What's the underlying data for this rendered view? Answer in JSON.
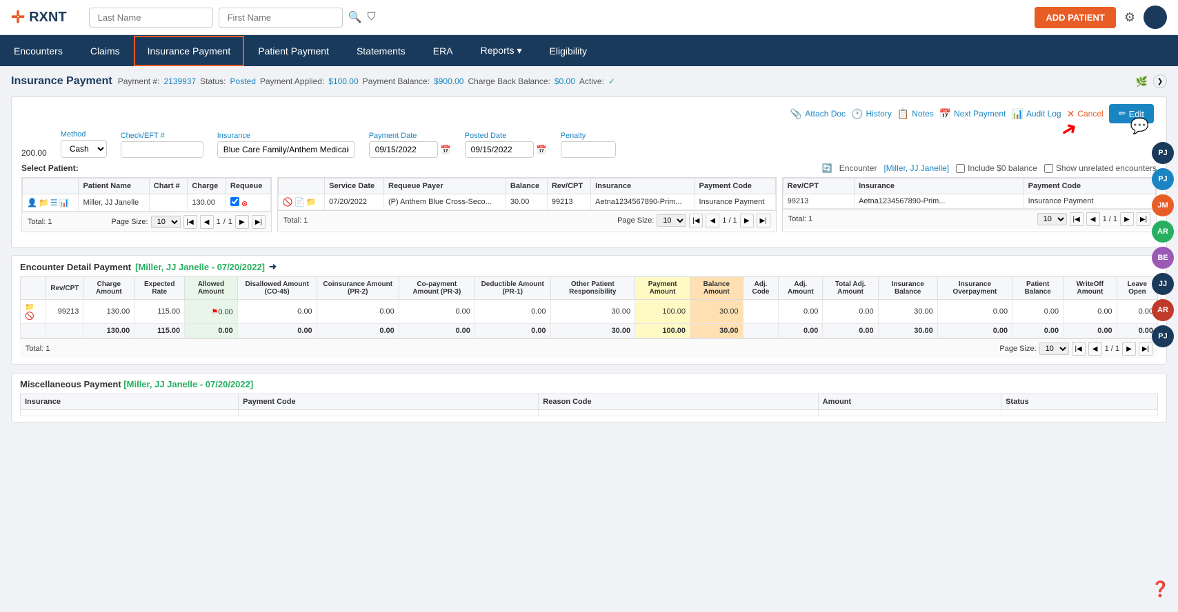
{
  "header": {
    "logo_text": "RXNT",
    "search_lastname_placeholder": "Last Name",
    "search_firstname_placeholder": "First Name",
    "add_patient_label": "ADD PATIENT"
  },
  "nav": {
    "items": [
      {
        "label": "Encounters",
        "active": false
      },
      {
        "label": "Claims",
        "active": false
      },
      {
        "label": "Insurance Payment",
        "active": true
      },
      {
        "label": "Patient Payment",
        "active": false
      },
      {
        "label": "Statements",
        "active": false
      },
      {
        "label": "ERA",
        "active": false
      },
      {
        "label": "Reports",
        "active": false,
        "has_dropdown": true
      },
      {
        "label": "Eligibility",
        "active": false
      }
    ]
  },
  "page": {
    "title": "Insurance Payment",
    "payment_num_label": "Payment #:",
    "payment_num": "2139937",
    "status_label": "Status:",
    "status_value": "Posted",
    "payment_applied_label": "Payment Applied:",
    "payment_applied_value": "$100.00",
    "payment_balance_label": "Payment Balance:",
    "payment_balance_value": "$900.00",
    "chargeback_label": "Charge Back Balance:",
    "chargeback_value": "$0.00",
    "active_label": "Active:"
  },
  "toolbar": {
    "attach_doc": "Attach Doc",
    "history": "History",
    "notes": "Notes",
    "next_payment": "Next Payment",
    "audit_log": "Audit Log",
    "cancel": "Cancel",
    "edit": "Edit"
  },
  "form": {
    "amount_value": "200.00",
    "method_label": "Method",
    "method_value": "Cash",
    "check_eft_label": "Check/EFT #",
    "insurance_label": "Insurance",
    "insurance_value": "Blue Care Family/Anthem Medicaid",
    "payment_date_label": "Payment Date",
    "payment_date_value": "09/15/2022",
    "posted_date_label": "Posted Date",
    "posted_date_value": "09/15/2022",
    "penalty_label": "Penalty"
  },
  "patient_section": {
    "label": "Select Patient:",
    "encounter_label": "Encounter",
    "encounter_name": "[Miller, JJ Janelle]",
    "include_zero_label": "Include $0 balance",
    "show_unrelated_label": "Show unrelated encounters"
  },
  "patients_table": {
    "headers": [
      "",
      "",
      "Patient Name",
      "Chart #",
      "Charge",
      "Requeue"
    ],
    "rows": [
      {
        "name": "Miller, JJ Janelle",
        "chart": "",
        "charge": "130.00",
        "requeue": true
      }
    ],
    "total": "Total: 1",
    "page_size": "10",
    "page": "1",
    "total_pages": "1"
  },
  "encounters_table": {
    "headers": [
      "",
      "",
      "Service Date",
      "Requeue Payer",
      "Balance",
      "Rev/CPT",
      "Insurance",
      "Payment Code"
    ],
    "rows": [
      {
        "service_date": "07/20/2022",
        "requeue_payer": "(P) Anthem Blue Cross-Seco...",
        "balance": "30.00",
        "rev_cpt": "99213",
        "insurance": "Aetna1234567890-Prim...",
        "payment_code": "Insurance Payment"
      }
    ],
    "total": "Total: 1",
    "page_size": "10",
    "page": "1",
    "total_pages": "1"
  },
  "detail_section": {
    "title": "Encounter Detail Payment",
    "patient_name": "[Miller, JJ Janelle - 07/20/2022]",
    "headers": [
      "Rev/CPT",
      "Charge Amount",
      "Expected Rate",
      "Allowed Amount",
      "Disallowed Amount (CO-45)",
      "Coinsurance Amount (PR-2)",
      "Co-payment Amount (PR-3)",
      "Deductible Amount (PR-1)",
      "Other Patient Responsibility",
      "Payment Amount",
      "Balance Amount",
      "Adj. Code",
      "Adj. Amount",
      "Total Adj. Amount",
      "Insurance Balance",
      "Insurance Overpayment",
      "Patient Balance",
      "WriteOff Amount",
      "Leave Open"
    ],
    "rows": [
      {
        "rev_cpt": "99213",
        "charge": "130.00",
        "expected": "115.00",
        "allowed": "0.00",
        "disallowed": "0.00",
        "coinsurance": "0.00",
        "copayment": "0.00",
        "deductible": "0.00",
        "other_resp": "30.00",
        "payment": "100.00",
        "balance": "30.00",
        "adj_code": "",
        "adj_amount": "0.00",
        "total_adj": "0.00",
        "ins_balance": "30.00",
        "ins_overpay": "0.00",
        "patient_balance": "0.00",
        "writeoff": "0.00",
        "leave_open": "0.00"
      }
    ],
    "totals": {
      "charge": "130.00",
      "expected": "115.00",
      "allowed": "0.00",
      "disallowed": "0.00",
      "coinsurance": "0.00",
      "copayment": "0.00",
      "deductible": "0.00",
      "other_resp": "30.00",
      "payment": "100.00",
      "balance": "30.00",
      "adj_amount": "0.00",
      "total_adj": "0.00",
      "ins_balance": "30.00",
      "ins_overpay": "0.00",
      "patient_balance": "0.00",
      "writeoff": "0.00",
      "leave_open": "0.00"
    },
    "total": "Total: 1",
    "page_size": "10",
    "page": "1",
    "total_pages": "1"
  },
  "misc_section": {
    "title": "Miscellaneous Payment",
    "patient_name": "[Miller, JJ Janelle - 07/20/2022]",
    "headers": [
      "Insurance",
      "Payment Code",
      "Reason Code",
      "Amount",
      "Status"
    ]
  },
  "side_avatars": [
    {
      "initials": "PJ",
      "bg": "#1a3a5c"
    },
    {
      "initials": "PJ",
      "bg": "#1a85c2"
    },
    {
      "initials": "JM",
      "bg": "#e85c25"
    },
    {
      "initials": "AR",
      "bg": "#27ae60"
    },
    {
      "initials": "BE",
      "bg": "#9b59b6"
    },
    {
      "initials": "JJ",
      "bg": "#1a3a5c"
    },
    {
      "initials": "AR",
      "bg": "#e05"
    },
    {
      "initials": "PJ",
      "bg": "#1a3a5c"
    }
  ]
}
